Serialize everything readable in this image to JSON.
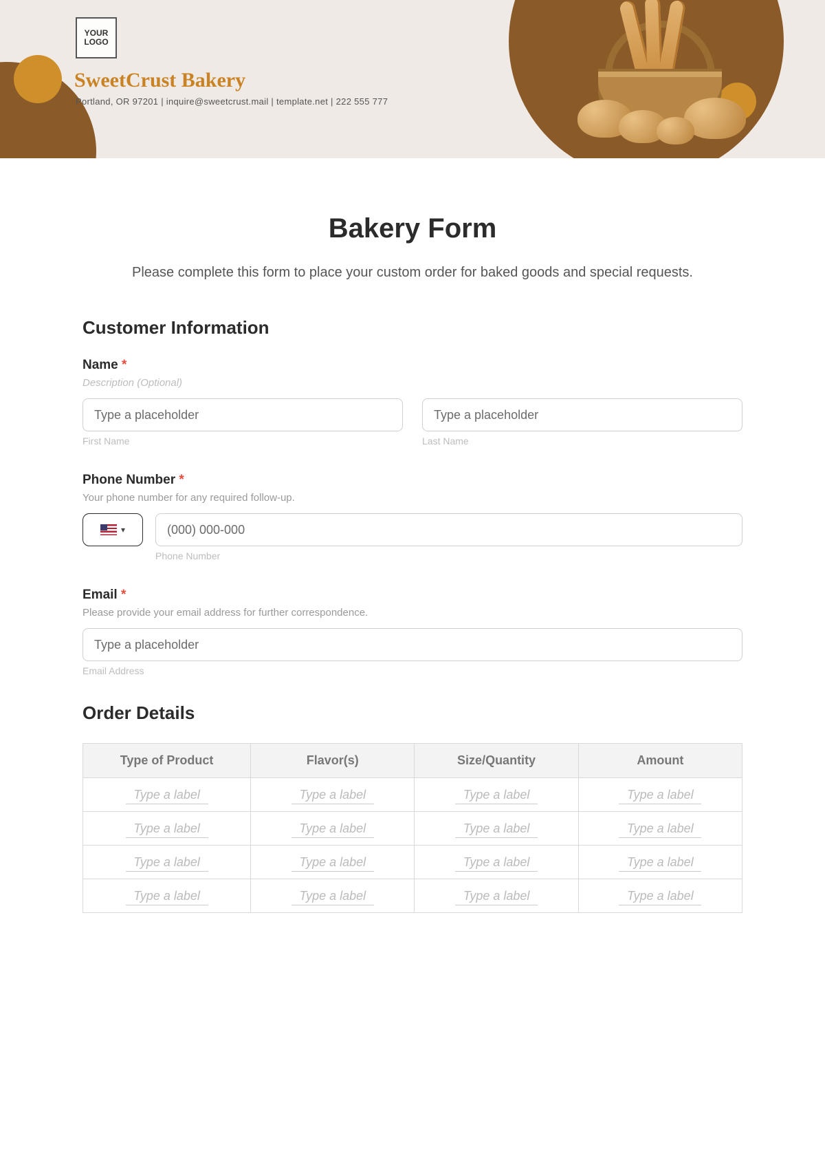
{
  "header": {
    "logo_text": "YOUR\nLOGO",
    "company": "SweetCrust Bakery",
    "contact_line": "Portland, OR 97201 | inquire@sweetcrust.mail | template.net | 222 555 777"
  },
  "form": {
    "title": "Bakery Form",
    "intro": "Please complete this form to place your custom order for baked goods and special requests."
  },
  "customer": {
    "heading": "Customer Information",
    "name": {
      "label": "Name",
      "required": "*",
      "desc": "Description (Optional)",
      "first_ph": "Type a placeholder",
      "first_sub": "First Name",
      "last_ph": "Type a placeholder",
      "last_sub": "Last Name"
    },
    "phone": {
      "label": "Phone Number",
      "required": "*",
      "desc": "Your phone number for any required follow-up.",
      "placeholder": "(000) 000-000",
      "sub": "Phone Number"
    },
    "email": {
      "label": "Email",
      "required": "*",
      "desc": "Please provide your email address for further correspondence.",
      "placeholder": "Type a placeholder",
      "sub": "Email Address"
    }
  },
  "order": {
    "heading": "Order Details",
    "columns": [
      "Type of Product",
      "Flavor(s)",
      "Size/Quantity",
      "Amount"
    ],
    "cell_placeholder": "Type a label",
    "rows": 4
  }
}
